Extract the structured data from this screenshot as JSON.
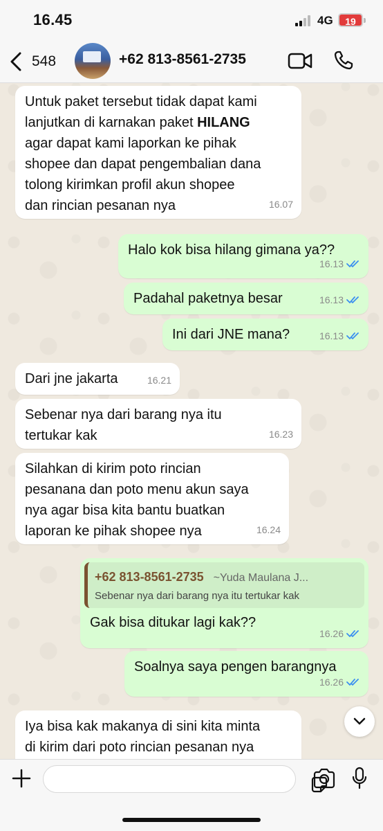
{
  "status_bar": {
    "time": "16.45",
    "network": "4G",
    "battery": "19"
  },
  "header": {
    "back_count": "548",
    "contact": "+62 813-8561-2735"
  },
  "messages": [
    {
      "text": "Untuk paket tersebut tidak dapat kami\nlanjutkan di karnakan paket ",
      "bold": "HILANG",
      "text_after": "\nagar dapat kami laporkan ke pihak\nshopee dan dapat pengembalian dana\ntolong kirimkan profil akun shopee\ndan rincian pesanan nya",
      "time": "16.07"
    },
    {
      "text": "Halo kok bisa hilang gimana ya??",
      "time": "16.13"
    },
    {
      "text": "Padahal paketnya besar",
      "time": "16.13"
    },
    {
      "text": "Ini dari JNE mana?",
      "time": "16.13"
    },
    {
      "text": "Dari jne jakarta",
      "time": "16.21"
    },
    {
      "text": "Sebenar nya dari barang nya itu\ntertukar kak",
      "time": "16.23"
    },
    {
      "text": "Silahkan di kirim poto rincian\npesanana dan poto menu akun saya\nnya agar bisa kita bantu buatkan\nlaporan ke pihak shopee nya",
      "time": "16.24"
    },
    {
      "quote_number": "+62 813-8561-2735",
      "quote_name": "~Yuda Maulana J...",
      "quote_text": "Sebenar nya dari barang nya itu tertukar kak",
      "text": "Gak bisa ditukar lagi kak??",
      "time": "16.26"
    },
    {
      "text": "Soalnya saya pengen barangnya",
      "time": "16.26"
    },
    {
      "text": "Iya bisa kak makanya di sini kita minta\ndi kirim dari poto rincian pesanan nya"
    }
  ],
  "colors": {
    "incoming": "#ffffff",
    "outgoing": "#d9fdd3",
    "read_tick": "#3b8ff0",
    "quote_accent": "#7a5230",
    "battery": "#e23b3b"
  }
}
